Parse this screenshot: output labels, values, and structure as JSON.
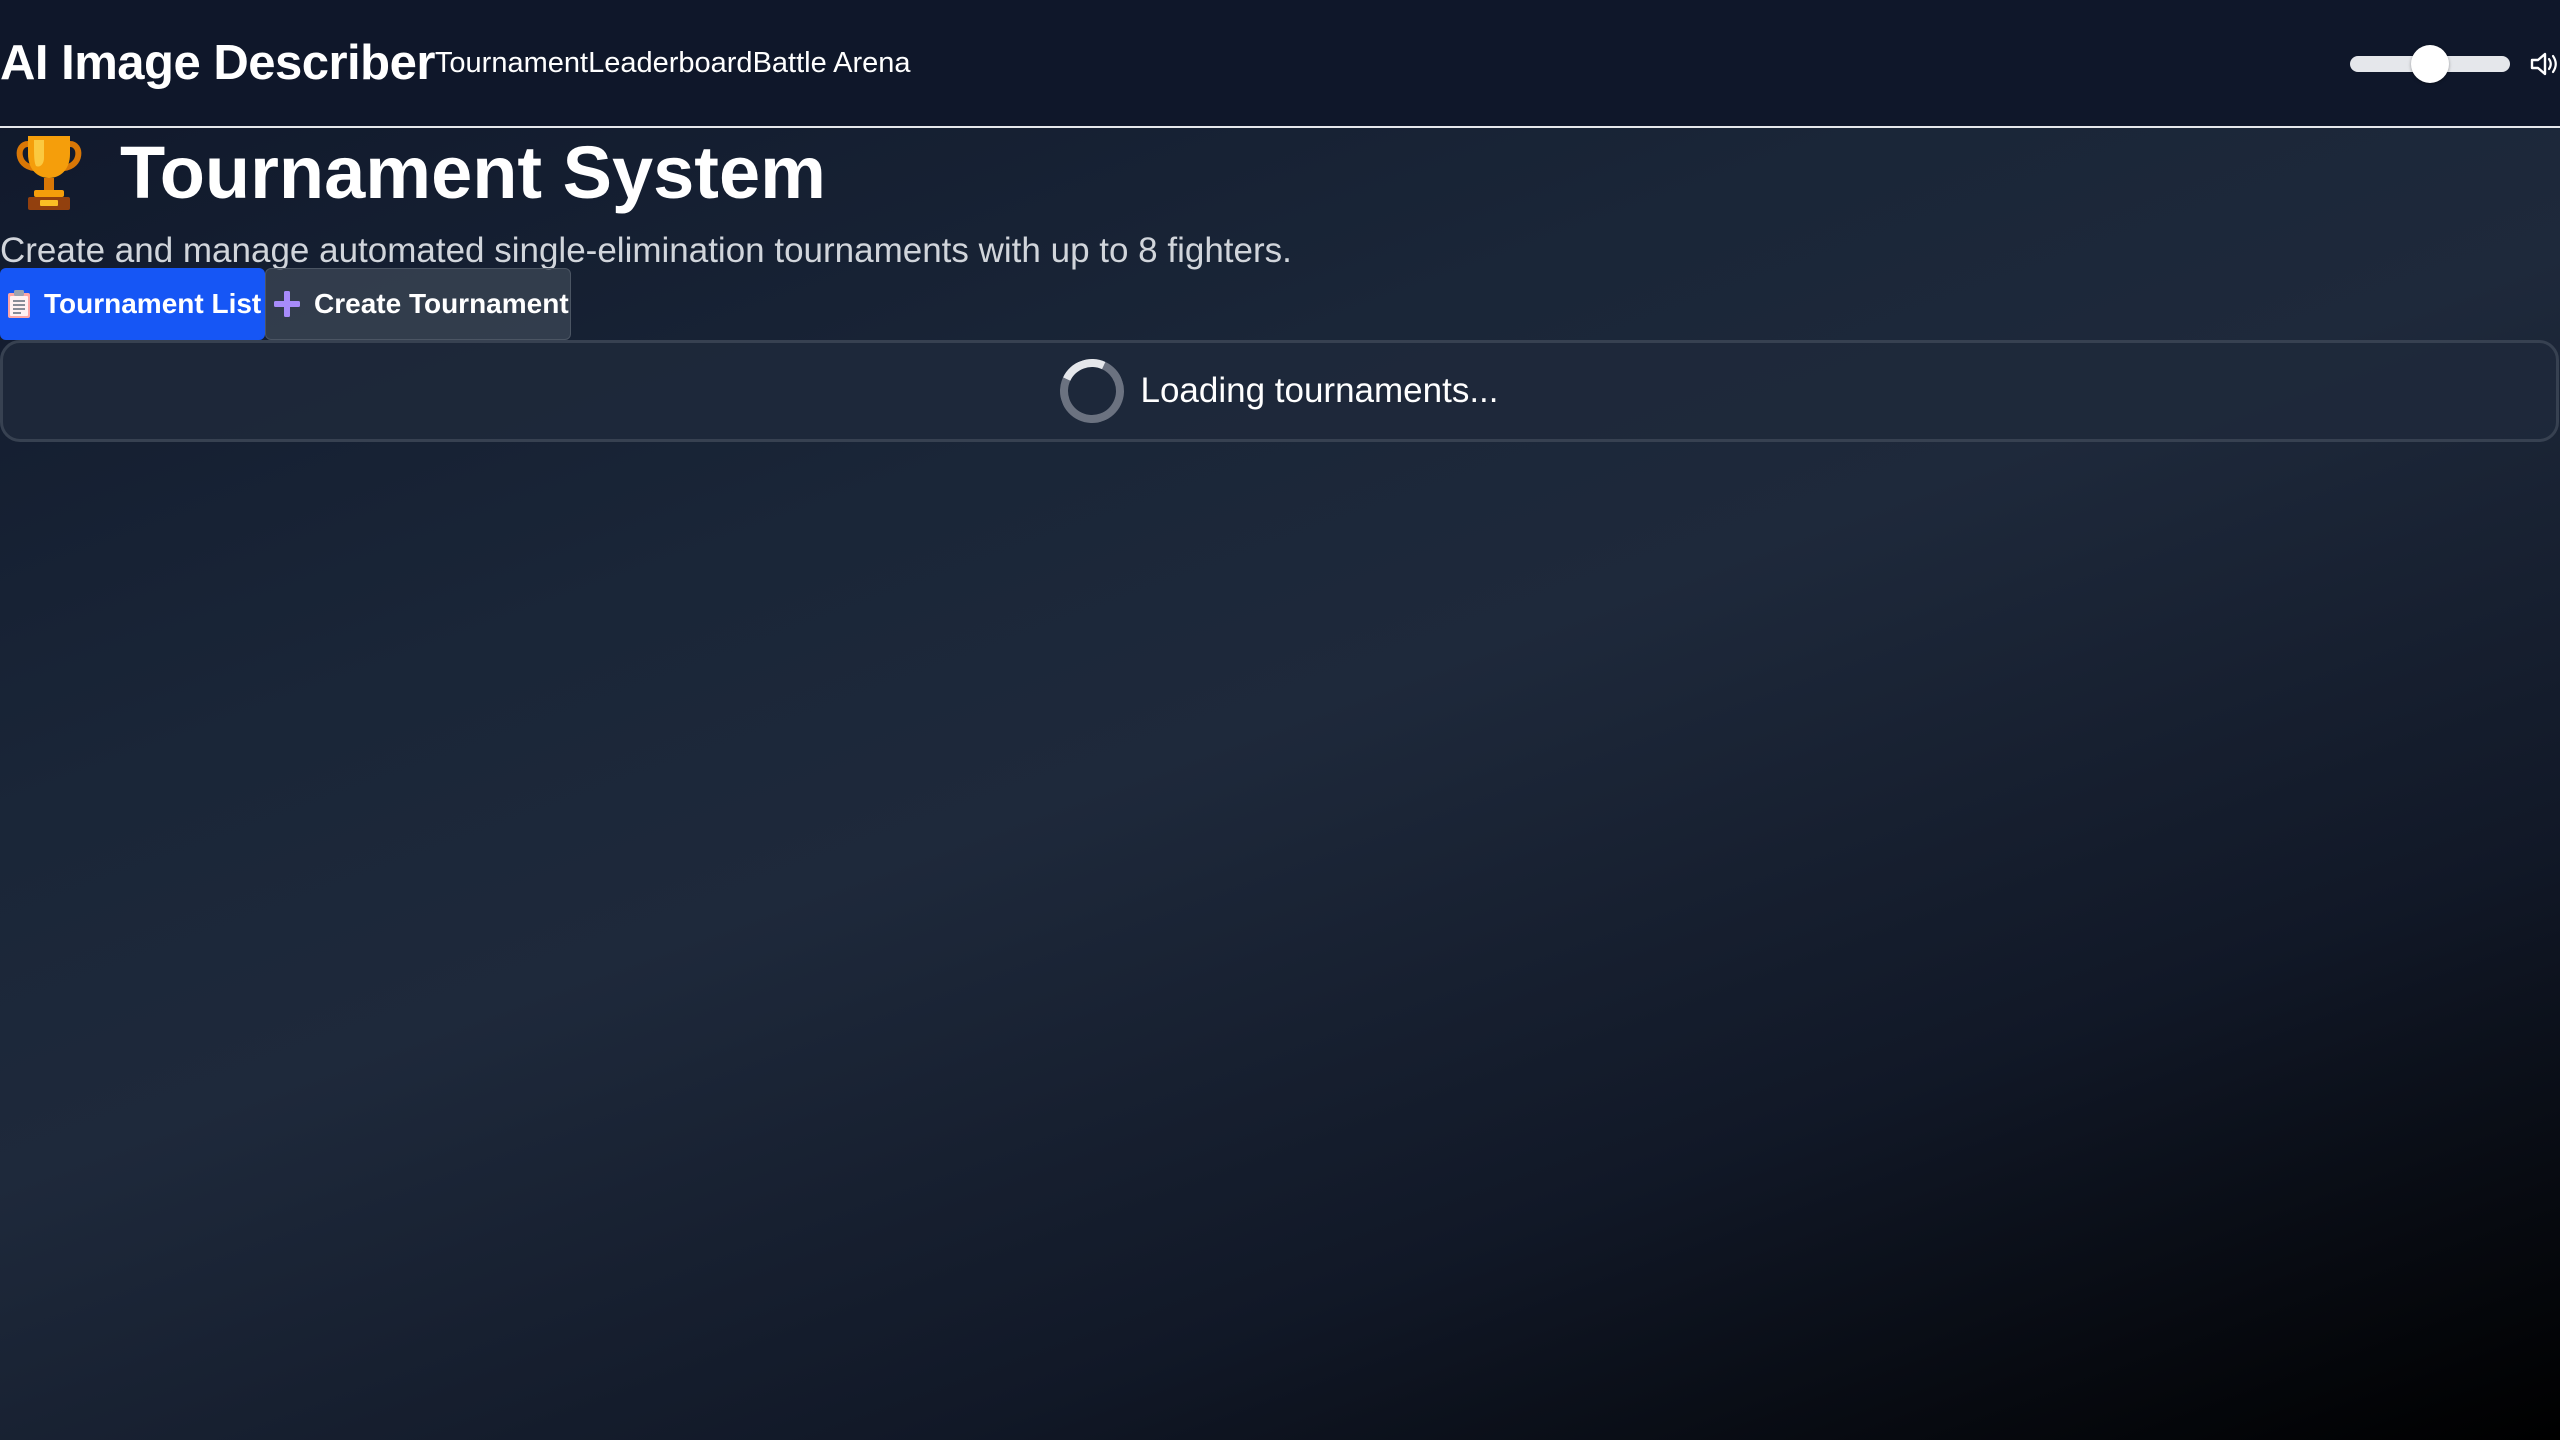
{
  "header": {
    "brand": "AI Image Describer",
    "nav": [
      {
        "label": "Tournament"
      },
      {
        "label": "Leaderboard"
      },
      {
        "label": "Battle Arena"
      }
    ],
    "volume_level": 0.5,
    "speaker_icon": "speaker-icon"
  },
  "hero": {
    "title": "Tournament System",
    "title_icon": "trophy-icon",
    "subtitle": "Create and manage automated single-elimination tournaments with up to 8 fighters."
  },
  "tabs": [
    {
      "label": "Tournament List",
      "icon": "clipboard-icon",
      "active": true
    },
    {
      "label": "Create Tournament",
      "icon": "plus-icon",
      "active": false
    }
  ],
  "status": {
    "loading_text": "Loading tournaments...",
    "icon": "spinner-icon"
  },
  "colors": {
    "accent": "#1656f5",
    "header_bg": "#0f172a",
    "panel_border": "#374151"
  }
}
